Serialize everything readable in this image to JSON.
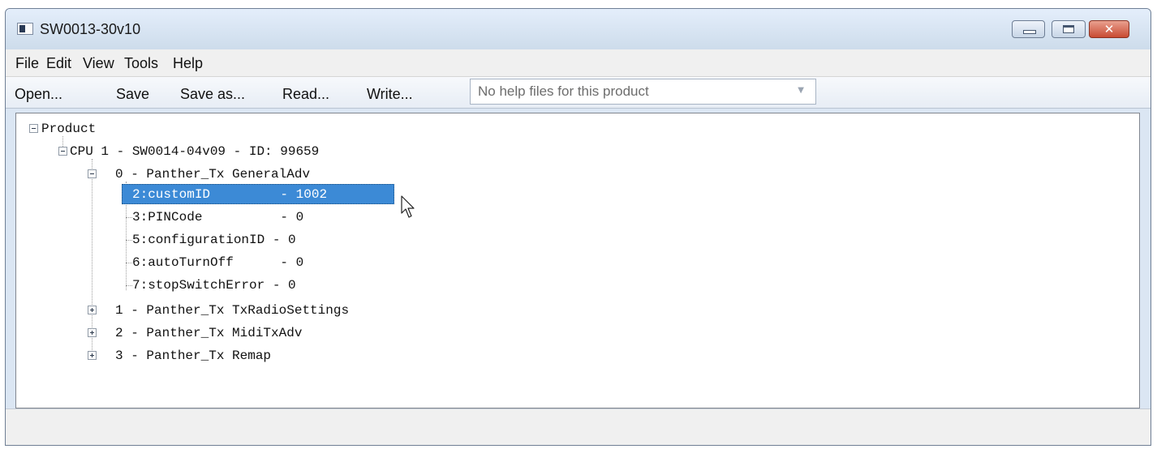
{
  "window": {
    "title": "SW0013-30v10"
  },
  "menu": {
    "items": [
      "File",
      "Edit",
      "View",
      "Tools",
      "Help"
    ]
  },
  "toolbar": {
    "open_label": "Open...",
    "save_label": "Save",
    "save_as_label": "Save as...",
    "read_label": "Read...",
    "write_label": "Write...",
    "help_combo_value": "No help files for this product"
  },
  "tree": {
    "root": "Product",
    "cpu": "CPU 1 - SW0014-04v09 - ID: 99659",
    "groups": [
      {
        "label": "0 - Panther_Tx GeneralAdv",
        "expanded": true,
        "params": [
          {
            "label": "2:customID         - 1002",
            "selected": true
          },
          {
            "label": "3:PINCode          - 0",
            "selected": false
          },
          {
            "label": "5:configurationID - 0",
            "selected": false
          },
          {
            "label": "6:autoTurnOff      - 0",
            "selected": false
          },
          {
            "label": "7:stopSwitchError - 0",
            "selected": false
          }
        ]
      },
      {
        "label": "1 - Panther_Tx TxRadioSettings",
        "expanded": false
      },
      {
        "label": "2 - Panther_Tx MidiTxAdv",
        "expanded": false
      },
      {
        "label": "3 - Panther_Tx Remap",
        "expanded": false
      }
    ]
  },
  "status": {
    "text": ""
  },
  "colors": {
    "selection": "#3c8ad6",
    "close_button": "#c94b33",
    "frame": "#dbe6f3"
  }
}
